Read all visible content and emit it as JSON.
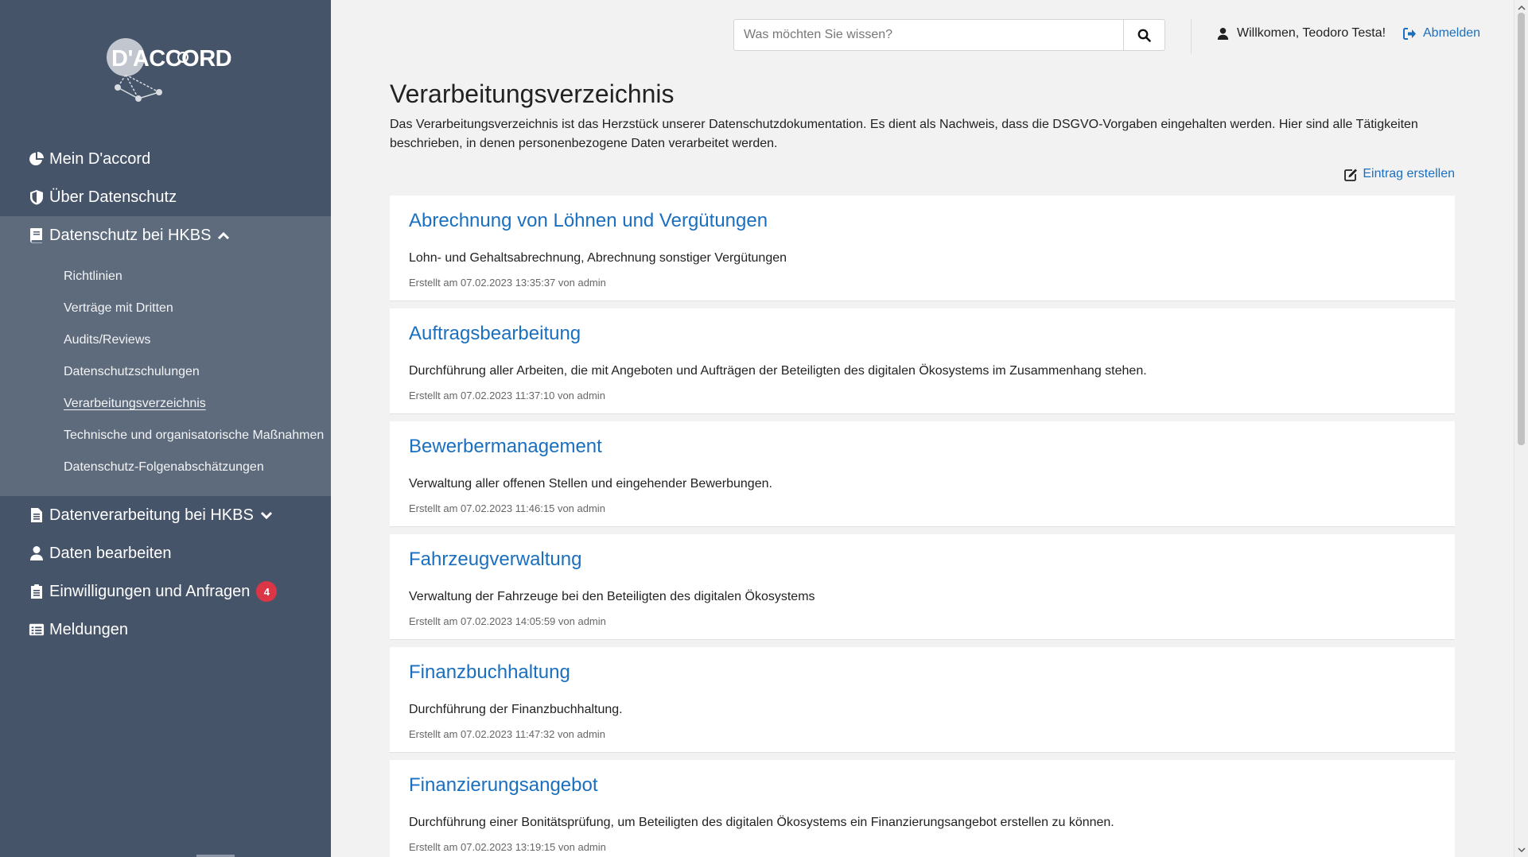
{
  "sidebar": {
    "logo": {
      "text": "D'ACCORD"
    },
    "items": [
      {
        "label": "Mein D'accord",
        "icon": "pie-chart-icon"
      },
      {
        "label": "Über Datenschutz",
        "icon": "shield-icon"
      },
      {
        "label": "Datenschutz bei HKBS",
        "icon": "book-icon",
        "expanded": true,
        "children": [
          {
            "label": "Richtlinien"
          },
          {
            "label": "Verträge mit Dritten"
          },
          {
            "label": "Audits/Reviews"
          },
          {
            "label": "Datenschutzschulungen"
          },
          {
            "label": "Verarbeitungsverzeichnis",
            "active": true
          },
          {
            "label": "Technische und organisatorische Maßnahmen"
          },
          {
            "label": "Datenschutz-Folgenabschätzungen"
          }
        ]
      },
      {
        "label": "Datenverarbeitung bei HKBS",
        "icon": "file-icon",
        "expanded": false
      },
      {
        "label": "Daten bearbeiten",
        "icon": "user-icon"
      },
      {
        "label": "Einwilligungen und Anfragen",
        "icon": "clipboard-icon",
        "badge": "4"
      },
      {
        "label": "Meldungen",
        "icon": "list-icon"
      }
    ]
  },
  "header": {
    "search_placeholder": "Was möchten Sie wissen?",
    "welcome": "Willkomen, Teodoro Testa!",
    "logout": "Abmelden"
  },
  "main": {
    "title": "Verarbeitungsverzeichnis",
    "description": "Das Verarbeitungsverzeichnis ist das Herzstück unserer Datenschutzdokumentation. Es dient als Nachweis, dass die DSGVO-Vorgaben eingehalten werden. Hier sind alle Tätigkeiten beschrieben, in denen personenbezogene Daten verarbeitet werden.",
    "create_label": "Eintrag erstellen",
    "entries": [
      {
        "title": "Abrechnung von Löhnen und Vergütungen",
        "description": "Lohn- und Gehaltsabrechnung, Abrechnung sonstiger Vergütungen",
        "meta": "Erstellt am 07.02.2023 13:35:37 von admin"
      },
      {
        "title": "Auftragsbearbeitung",
        "description": "Durchführung aller Arbeiten, die mit Angeboten und Aufträgen der Beteiligten des digitalen Ökosystems im Zusammenhang stehen.",
        "meta": "Erstellt am 07.02.2023 11:37:10 von admin"
      },
      {
        "title": "Bewerbermanagement",
        "description": "Verwaltung aller offenen Stellen und eingehender Bewerbungen.",
        "meta": "Erstellt am 07.02.2023 11:46:15 von admin"
      },
      {
        "title": "Fahrzeugverwaltung",
        "description": "Verwaltung der Fahrzeuge bei den Beteiligten des digitalen Ökosystems",
        "meta": "Erstellt am 07.02.2023 14:05:59 von admin"
      },
      {
        "title": "Finanzbuchhaltung",
        "description": "Durchführung der Finanzbuchhaltung.",
        "meta": "Erstellt am 07.02.2023 11:47:32 von admin"
      },
      {
        "title": "Finanzierungsangebot",
        "description": "Durchführung einer Bonitätsprüfung, um Beteiligten des digitalen Ökosystems ein Finanzierungsangebot erstellen zu können.",
        "meta": "Erstellt am 07.02.2023 13:19:15 von admin"
      }
    ]
  },
  "colors": {
    "sidebar": "#465469",
    "sidebar_group": "#5e6b7d",
    "link": "#1a6fbf",
    "badge": "#dc3545",
    "background": "#f2f2f2"
  }
}
